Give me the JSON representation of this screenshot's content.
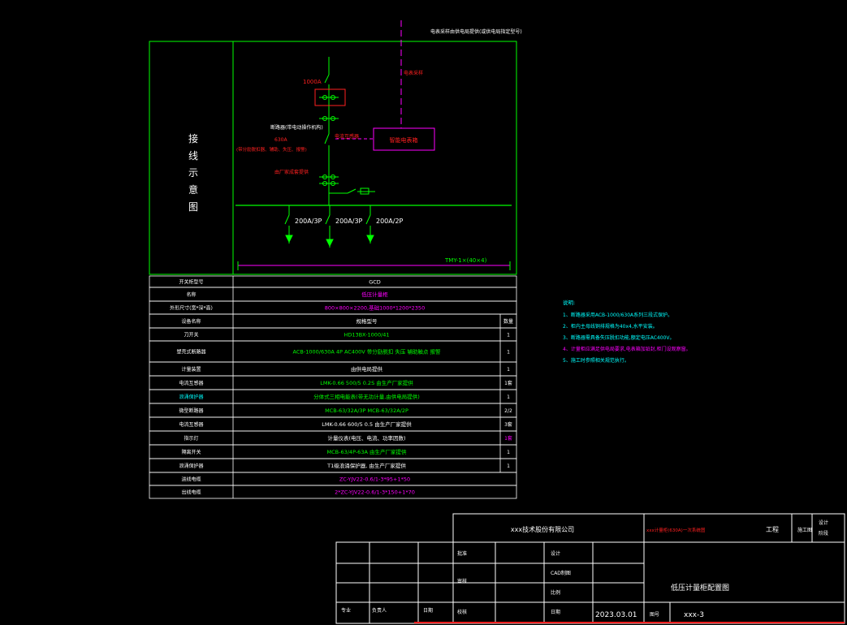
{
  "diagram": {
    "top_note": "电表采样由供电局提供(或供电局指定型号)",
    "left_title_chars": [
      "接",
      "线",
      "示",
      "意",
      "图"
    ],
    "current_1000": "1000A",
    "mccb_label": "断路器(带电动操作机构)",
    "mccb_rating": "630A",
    "mccb_note": "(带分励脱扣器、辅助、失压、报警)",
    "ct_label": "电流互感器",
    "meter_line_label": "电表采样",
    "meter_box_label": "智能电表箱",
    "surge_label": "由厂家成套提供",
    "branch_labels": [
      "200A/3P",
      "200A/3P",
      "200A/2P"
    ],
    "busbar_label": "TMY-1×(40×4)"
  },
  "table": {
    "rows": [
      {
        "label": "开关柜型号",
        "value": "GCD",
        "qty": ""
      },
      {
        "label": "名称",
        "value": "低压计量柜",
        "qty": ""
      },
      {
        "label": "外形尺寸(宽*深*高)",
        "value": "800×800×2200,基础1000*1200*2350",
        "qty": ""
      },
      {
        "label": "设备名称",
        "value": "规格型号",
        "qty": "数量"
      },
      {
        "label": "刀开关",
        "value": "HD13BX-1000/41",
        "qty": "1"
      },
      {
        "label": "塑壳式断路器",
        "value": "ACB-1000/630A 4P AC400V 带分励脱扣 失压 辅助触点 报警",
        "qty": "1"
      },
      {
        "label": "计量装置",
        "value": "由供电局提供",
        "qty": "1"
      },
      {
        "label": "电流互感器",
        "value": "LMK-0.66  500/5 0.2S   由生产厂家提供",
        "qty": "1套"
      },
      {
        "label": "浪涌保护器",
        "value": "分体式三相电能表(带无功计量,由供电局提供)",
        "qty": "1"
      },
      {
        "label": "微型断路器",
        "value": "MCB-63/32A/3P   MCB-63/32A/2P",
        "qty": "2/2"
      },
      {
        "label": "电流互感器",
        "value": "LMK-0.66  600/5 0.5 由生产厂家提供",
        "qty": "3套"
      },
      {
        "label": "指示灯",
        "value": "计量仪表(电压、电流、功率因数)",
        "qty": "1套"
      },
      {
        "label": "隔离开关",
        "value": "MCB-63/4P-63A   由生产厂家提供",
        "qty": "1"
      },
      {
        "label": "浪涌保护器",
        "value": "T1级浪涌保护器, 由生产厂家提供",
        "qty": "1"
      },
      {
        "label": "进线电缆",
        "value": "ZC-YJV22-0.6/1-3*95+1*50",
        "qty": ""
      },
      {
        "label": "出线电缆",
        "value": "2*ZC-YJV22-0.6/1-3*150+1*70",
        "qty": ""
      }
    ]
  },
  "notes": {
    "title": "说明:",
    "items": [
      "1、断路器采用ACB-1000/630A系列三段式保护。",
      "2、柜内主母线铜排规格为40x4,水平安装。",
      "3、断路器需具备失压脱扣功能,额定电压AC400V。",
      "4、计量柜应满足供电局要求,电表箱加铅封,柜门设观察窗。",
      "5、施工时参照相关规范执行。"
    ]
  },
  "title_block": {
    "company": "xxx技术股份有限公司",
    "project_ref": "xxx计量柜(630A)一次系统图",
    "project_label": "工程",
    "stage_label": "施工图",
    "design_label": "设计",
    "check_stage_label": "阶段",
    "approve_label": "批准",
    "design2_label": "设计",
    "review_label": "审核",
    "cad_label": "CAD制图",
    "check_label": "校核",
    "scale_label": "比例",
    "date_label": "日期",
    "date_value": "2023.03.01",
    "drawing_title": "低压计量柜配置图",
    "drawing_no_label": "图号",
    "drawing_no": "xxx-3",
    "rev_labels": [
      "专业",
      "负责人",
      "日期"
    ]
  },
  "colors": {
    "frame": "#00ff00",
    "text": "#ffffff",
    "red": "#ff2020",
    "magenta": "#ff00ff",
    "cyan": "#00ffff",
    "yellow": "#ffff00"
  }
}
